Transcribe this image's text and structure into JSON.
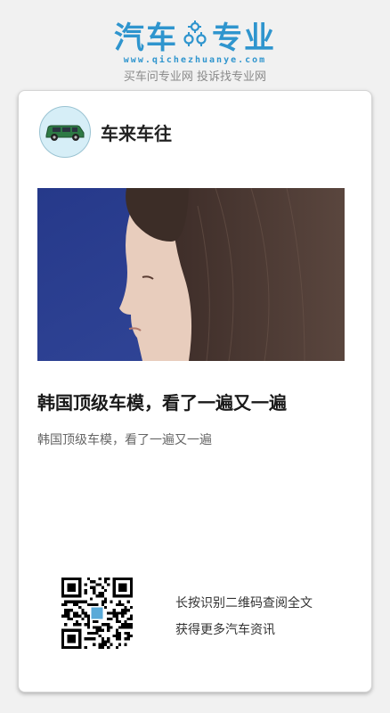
{
  "brand": {
    "name_left": "汽车",
    "name_right": "专业",
    "url": "www.qichezhuanye.com",
    "slogan": "买车问专业网 投诉找专业网",
    "color": "#2f95ce"
  },
  "author": {
    "name": "车来车往",
    "avatar_icon": "green-car-icon"
  },
  "article": {
    "title": "韩国顶级车模，看了一遍又一遍",
    "summary": "韩国顶级车模，看了一遍又一遍"
  },
  "qr": {
    "line1": "长按识别二维码查阅全文",
    "line2": "获得更多汽车资讯"
  }
}
